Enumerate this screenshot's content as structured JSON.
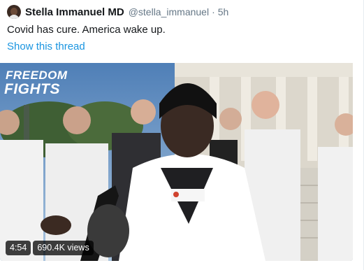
{
  "tweet": {
    "author_name": "Stella Immanuel MD",
    "handle": "@stella_immanuel",
    "separator": "·",
    "time": "5h",
    "text": "Covid has cure. America wake up.",
    "show_thread": "Show this thread"
  },
  "media": {
    "watermark_line1": "FREEDOM",
    "watermark_line2": "FIGHTS",
    "duration": "4:54",
    "views": "690.4K views"
  },
  "colors": {
    "link": "#1b95e0",
    "secondary_text": "#657786",
    "primary_text": "#14171a"
  }
}
